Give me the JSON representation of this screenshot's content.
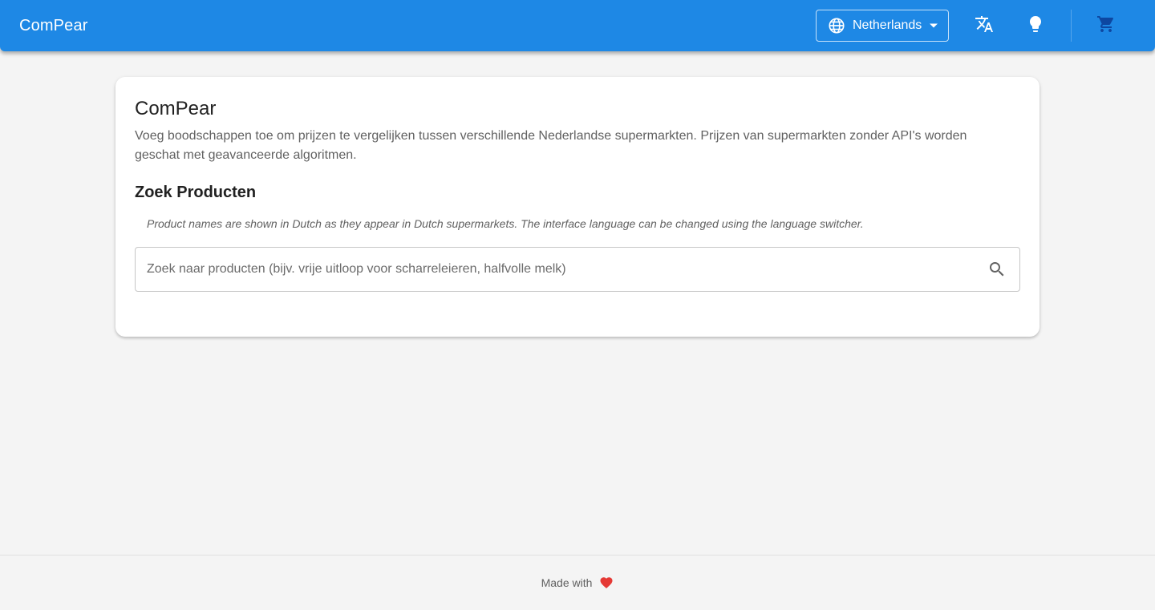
{
  "header": {
    "brand": "ComPear",
    "country_select": {
      "selected": "Netherlands"
    },
    "icons": {
      "country": "globe-icon",
      "dropdown": "caret-down-icon",
      "language": "translate-icon",
      "theme": "lightbulb-icon",
      "cart": "shopping-cart-icon"
    },
    "color": "#1e88e5"
  },
  "main": {
    "title": "ComPear",
    "description": "Voeg boodschappen toe om prijzen te vergelijken tussen verschillende Nederlandse supermarkten. Prijzen van supermarkten zonder API's worden geschat met geavanceerde algoritmen.",
    "search_section": {
      "title": "Zoek Producten",
      "note": "Product names are shown in Dutch as they appear in Dutch supermarkets. The interface language can be changed using the language switcher.",
      "placeholder": "Zoek naar producten (bijv. vrije uitloop voor scharreleieren, halfvolle melk)",
      "value": "",
      "icon": "search-icon"
    }
  },
  "footer": {
    "text": "Made with",
    "icon": "heart-icon",
    "icon_color": "#e53935"
  }
}
